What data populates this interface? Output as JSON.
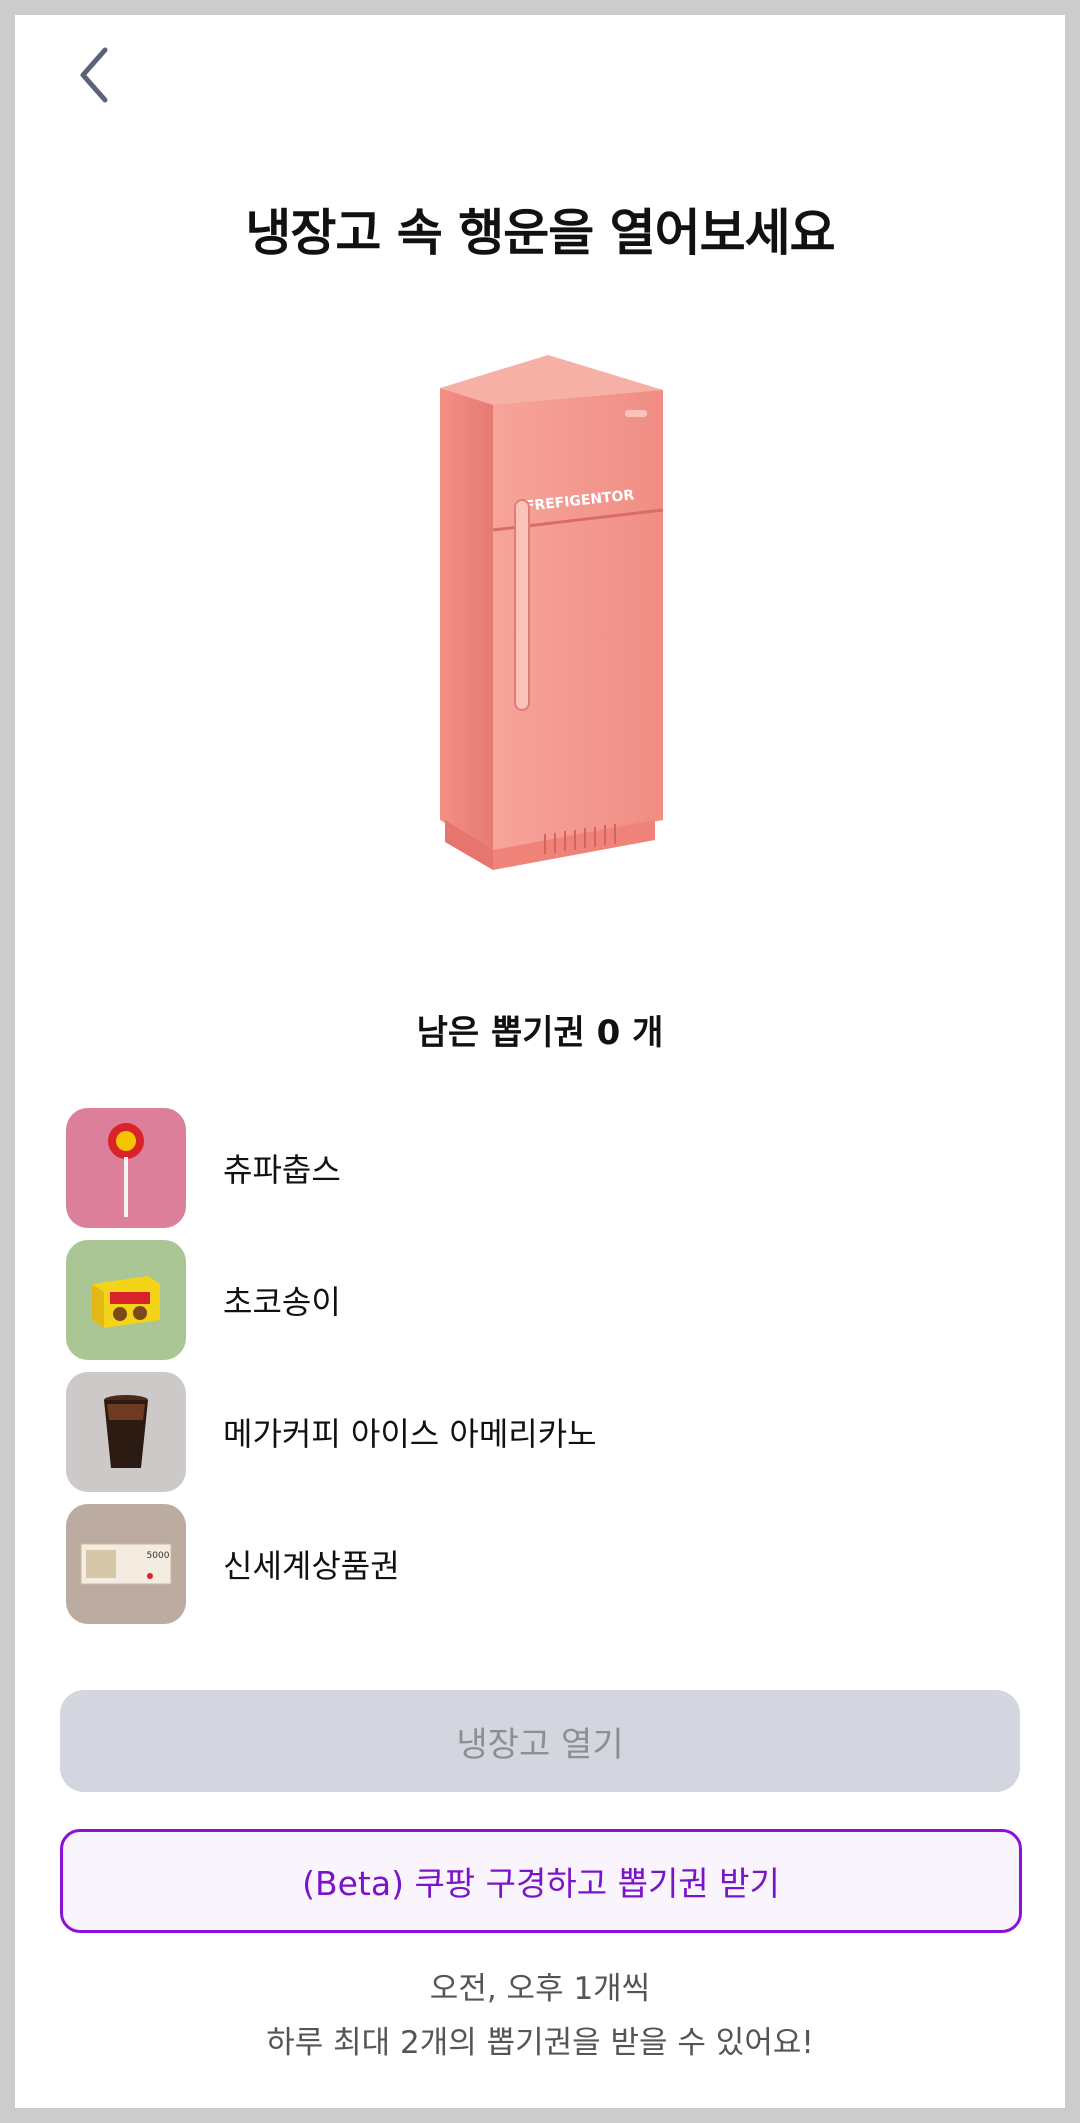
{
  "header": {
    "back_icon": "chevron-left-icon"
  },
  "title": "냉장고 속 행운을 열어보세요",
  "fridge": {
    "brand_text": "FREFIGENTOR",
    "color": "#f28b82"
  },
  "remaining_text": "남은 뽑기권 0 개",
  "prizes": [
    {
      "name": "츄파춥스",
      "bg": "#dc7f9b",
      "icon": "lollipop-icon"
    },
    {
      "name": "초코송이",
      "bg": "#a9c694",
      "icon": "snack-box-icon"
    },
    {
      "name": "메가커피 아이스 아메리카노",
      "bg": "#cdc9c8",
      "icon": "iced-coffee-icon"
    },
    {
      "name": "신세계상품권",
      "bg": "#bcaba1",
      "icon": "gift-voucher-icon",
      "voucher_amount": "5000"
    }
  ],
  "buttons": {
    "open_label": "냉장고 열기",
    "coupang_label": "(Beta) 쿠팡 구경하고 뽑기권 받기"
  },
  "notes": {
    "line1": "오전, 오후 1개씩",
    "line2": "하루 최대 2개의 뽑기권을 받을 수 있어요!"
  },
  "colors": {
    "accent": "#8a12d8",
    "disabled_bg": "#d3d6de"
  }
}
